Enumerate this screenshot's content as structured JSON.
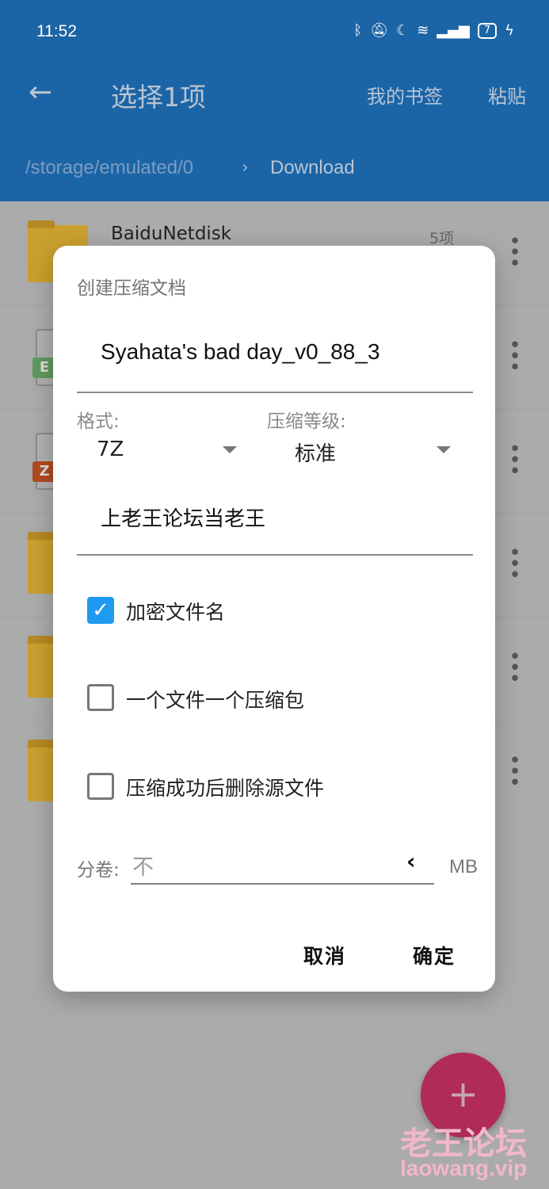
{
  "status": {
    "time": "11:52",
    "battery": "7",
    "icons": [
      "bluetooth-icon",
      "mute-icon",
      "moon-icon",
      "wifi-icon",
      "signal-4g-icon",
      "battery-icon",
      "charging-icon"
    ]
  },
  "appbar": {
    "title": "选择1项",
    "bookmarks": "我的书签",
    "paste": "粘贴",
    "color": "#1b65a7"
  },
  "breadcrumb": {
    "root": "/storage/emulated/0",
    "sep": "›",
    "current": "Download"
  },
  "list": [
    {
      "name": "BaiduNetdisk",
      "count": "5项",
      "type": "folder"
    },
    {
      "name": "",
      "type": "file",
      "badge": "E"
    },
    {
      "name": "",
      "type": "file",
      "badge": "Z"
    },
    {
      "name": "",
      "type": "folder"
    },
    {
      "name": "",
      "type": "folder"
    },
    {
      "name": "",
      "type": "folder"
    }
  ],
  "dialog": {
    "title": "创建压缩文档",
    "filename": "Syahata's bad day_v0_88_3",
    "format_label": "格式:",
    "format_value": "7Z",
    "level_label": "压缩等级:",
    "level_value": "标准",
    "password": "上老王论坛当老王",
    "options": [
      {
        "label": "加密文件名",
        "checked": true
      },
      {
        "label": "一个文件一个压缩包",
        "checked": false
      },
      {
        "label": "压缩成功后删除源文件",
        "checked": false
      }
    ],
    "split_label": "分卷:",
    "split_placeholder": "不",
    "split_arrow": "‹",
    "split_unit": "MB",
    "cancel": "取消",
    "ok": "确定"
  },
  "fab": {
    "label": "+",
    "color": "#b12b59"
  },
  "watermark": {
    "line1": "老王论坛",
    "line2": "laowang.vip"
  }
}
